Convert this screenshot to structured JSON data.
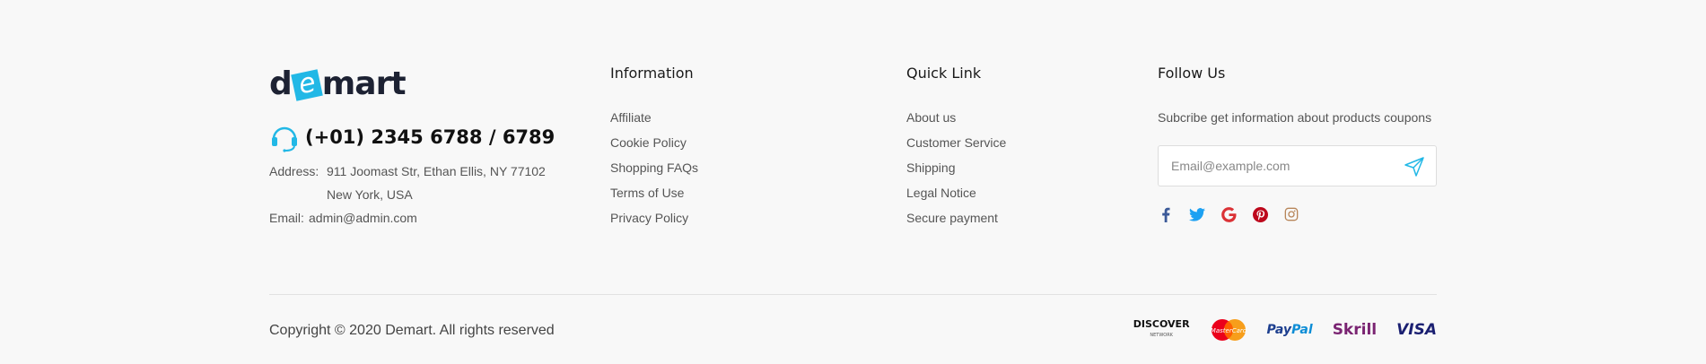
{
  "brand": {
    "logo_prefix": "d",
    "logo_letter": "e",
    "logo_suffix": "mart",
    "phone": "(+01) 2345 6788 / 6789",
    "address_label": "Address:",
    "address_line1": "911 Joomast Str, Ethan Ellis, NY 77102",
    "address_line2": "New York, USA",
    "email_label": "Email:",
    "email": "admin@admin.com",
    "accent_color": "#22b8e6"
  },
  "information": {
    "title": "Information",
    "links": [
      "Affiliate",
      "Cookie Policy",
      "Shopping FAQs",
      "Terms of Use",
      "Privacy Policy"
    ]
  },
  "quick_link": {
    "title": "Quick Link",
    "links": [
      "About us",
      "Customer Service",
      "Shipping",
      "Legal Notice",
      "Secure payment"
    ]
  },
  "follow_us": {
    "title": "Follow Us",
    "text": "Subcribe get information about products coupons",
    "email_placeholder": "Email@example.com",
    "social_icons": [
      "facebook-icon",
      "twitter-icon",
      "google-icon",
      "pinterest-icon",
      "instagram-icon"
    ]
  },
  "bottom": {
    "copyright": "Copyright © 2020 Demart. All rights reserved",
    "payments": {
      "discover": "DISCOVER",
      "discover_sub": "NETWORK",
      "mastercard": "MasterCard",
      "paypal_a": "Pay",
      "paypal_b": "Pal",
      "skrill": "Skrill",
      "visa": "VISA"
    }
  }
}
